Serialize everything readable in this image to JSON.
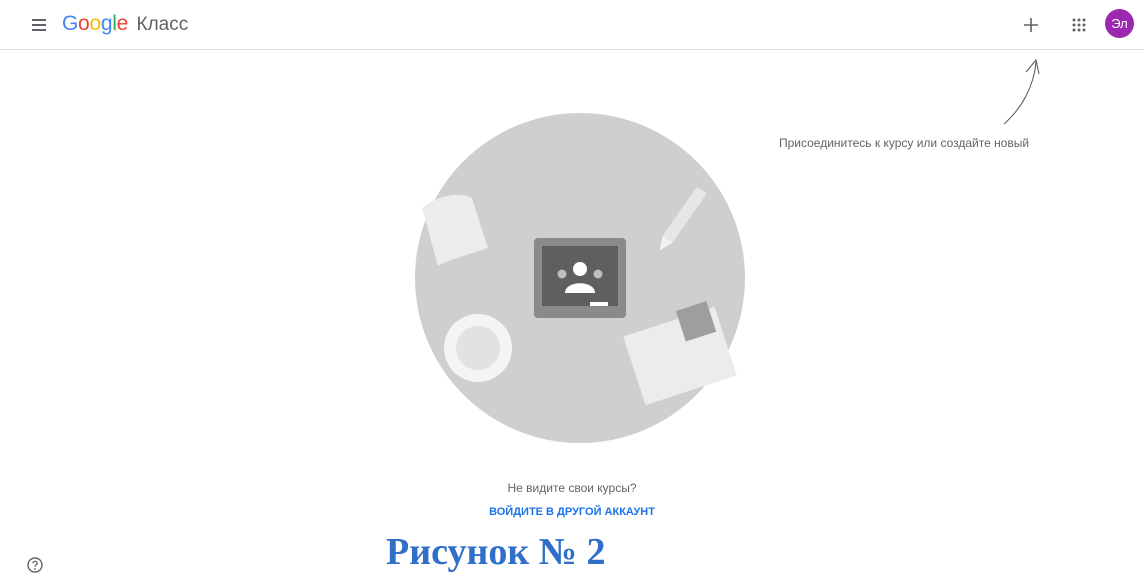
{
  "header": {
    "logo_letters": [
      "G",
      "o",
      "o",
      "g",
      "l",
      "e"
    ],
    "logo_colors": [
      "#4285F4",
      "#EA4335",
      "#FBBC05",
      "#4285F4",
      "#34A853",
      "#EA4335"
    ],
    "app_name": "Класс",
    "avatar_initials": "Эл",
    "avatar_color": "#9c27b0"
  },
  "hint": {
    "text": "Присоединитесь к курсу или создайте новый"
  },
  "empty_state": {
    "question": "Не видите свои курсы?",
    "switch_account_label": "ВОЙДИТЕ В ДРУГОЙ АККАУНТ"
  },
  "caption": "Рисунок № 2",
  "colors": {
    "accent": "#1a73e8",
    "caption": "#2f6fc8"
  },
  "icons": [
    "menu-icon",
    "plus-icon",
    "apps-grid-icon",
    "help-icon"
  ]
}
